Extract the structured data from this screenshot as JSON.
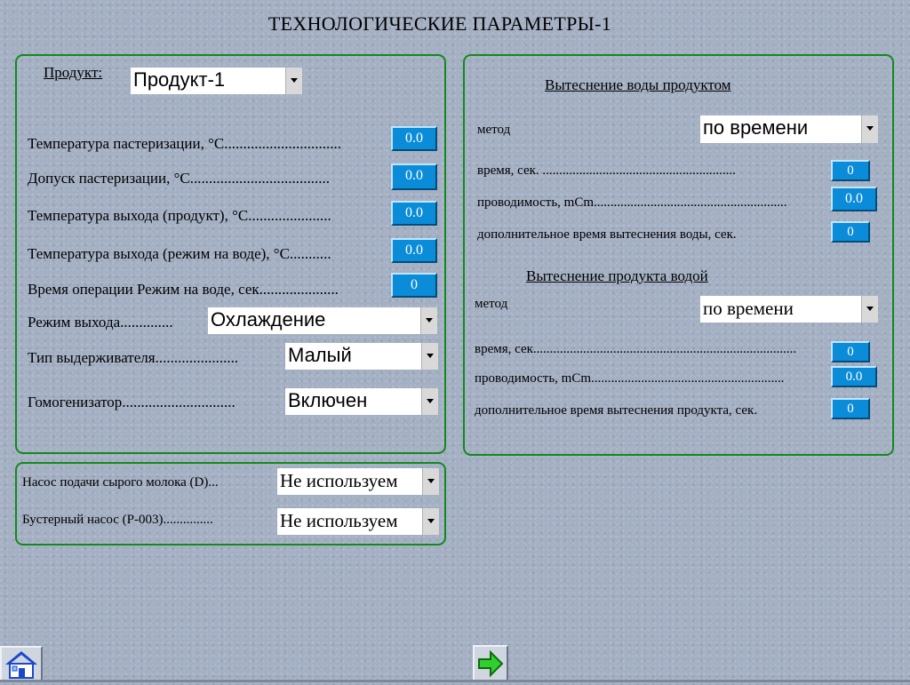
{
  "page": {
    "title": "ТЕХНОЛОГИЧЕСКИЕ ПАРАМЕТРЫ-1"
  },
  "left": {
    "product_label": "Продукт:",
    "product_value": "Продукт-1",
    "rows": [
      {
        "label": "Температура пастеризации, °С...............................",
        "value": "0.0"
      },
      {
        "label": "Допуск пастеризации, °С.....................................",
        "value": "0.0"
      },
      {
        "label": "Температура выхода (продукт), °С......................",
        "value": "0.0"
      },
      {
        "label": "Температура выхода (режим на воде), °С...........",
        "value": "0.0"
      },
      {
        "label": "Время операции Режим на воде, сек.....................",
        "value": "0"
      }
    ],
    "exit_mode_label": "Режим выхода..............",
    "exit_mode_value": "Охлаждение",
    "holder_label": "Тип выдерживателя......................",
    "holder_value": "Малый",
    "homogenizer_label": "Гомогенизатор..............................",
    "homogenizer_value": "Включен"
  },
  "pumps": {
    "raw_milk_label": "Насос подачи сырого молока (D)...",
    "raw_milk_value": "Не используем",
    "booster_label": "Бустерный насос (P-003)...............",
    "booster_value": "Не используем"
  },
  "right": {
    "water_title": "Вытеснение воды продуктом",
    "water_method_label": "метод",
    "water_method_value": "по времени",
    "water_time_label": "время, сек.   ..........................................................",
    "water_time_value": "0",
    "water_cond_label": "проводимость, mCm..........................................................",
    "water_cond_value": "0.0",
    "water_extra_label": "дополнительное время вытеснения воды, сек.",
    "water_extra_value": "0",
    "product_title": "Вытеснение продукта водой",
    "product_method_label": "метод",
    "product_method_value": "по времени",
    "product_time_label": "время, сек...............................................................................",
    "product_time_value": "0",
    "product_cond_label": "проводимость, mCm..........................................................",
    "product_cond_value": "0.0",
    "product_extra_label": "дополнительное время вытеснения продукта, сек.",
    "product_extra_value": "0"
  },
  "nav": {
    "home_icon": "home-icon",
    "next_icon": "arrow-right-icon"
  }
}
